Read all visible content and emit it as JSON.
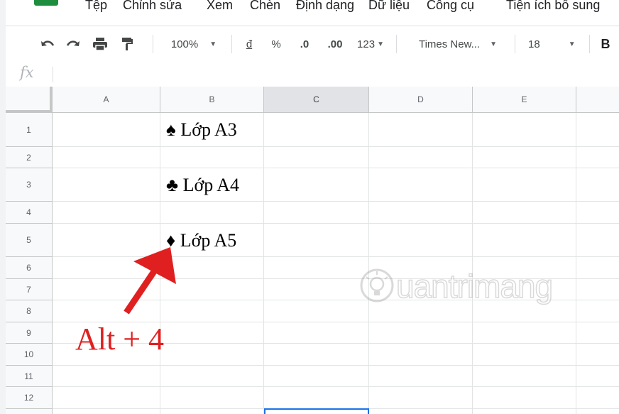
{
  "menubar": {
    "items": [
      "Tệp",
      "Chỉnh sửa",
      "Xem",
      "Chèn",
      "Định dạng",
      "Dữ liệu",
      "Công cụ",
      "Tiện ích bổ sung"
    ]
  },
  "toolbar": {
    "undo_icon": "undo-icon",
    "redo_icon": "redo-icon",
    "print_icon": "print-icon",
    "paint_icon": "paint-format-icon",
    "zoom": "100%",
    "currency": "đ",
    "percent": "%",
    "dec_less": ".0",
    "dec_more": ".00",
    "number_format": "123",
    "font": "Times New...",
    "font_size": "18",
    "bold": "B"
  },
  "formula_bar": {
    "fx_label": "fx",
    "value": ""
  },
  "columns": [
    "A",
    "B",
    "C",
    "D",
    "E"
  ],
  "rows": [
    "1",
    "2",
    "3",
    "4",
    "5",
    "6",
    "7",
    "8",
    "9",
    "10",
    "11",
    "12"
  ],
  "cells": {
    "B1": "♠ Lớp A3",
    "B3": "♣ Lớp A4",
    "B5": "♦ Lớp A5"
  },
  "annotation": {
    "text": "Alt + 4",
    "color": "#e02020"
  },
  "watermark": {
    "text": "uantrimang"
  },
  "colors": {
    "selection": "#1a73e8",
    "header_bg": "#f8f9fa",
    "grid": "#e2e3e3",
    "brand": "#1e8e3e"
  }
}
